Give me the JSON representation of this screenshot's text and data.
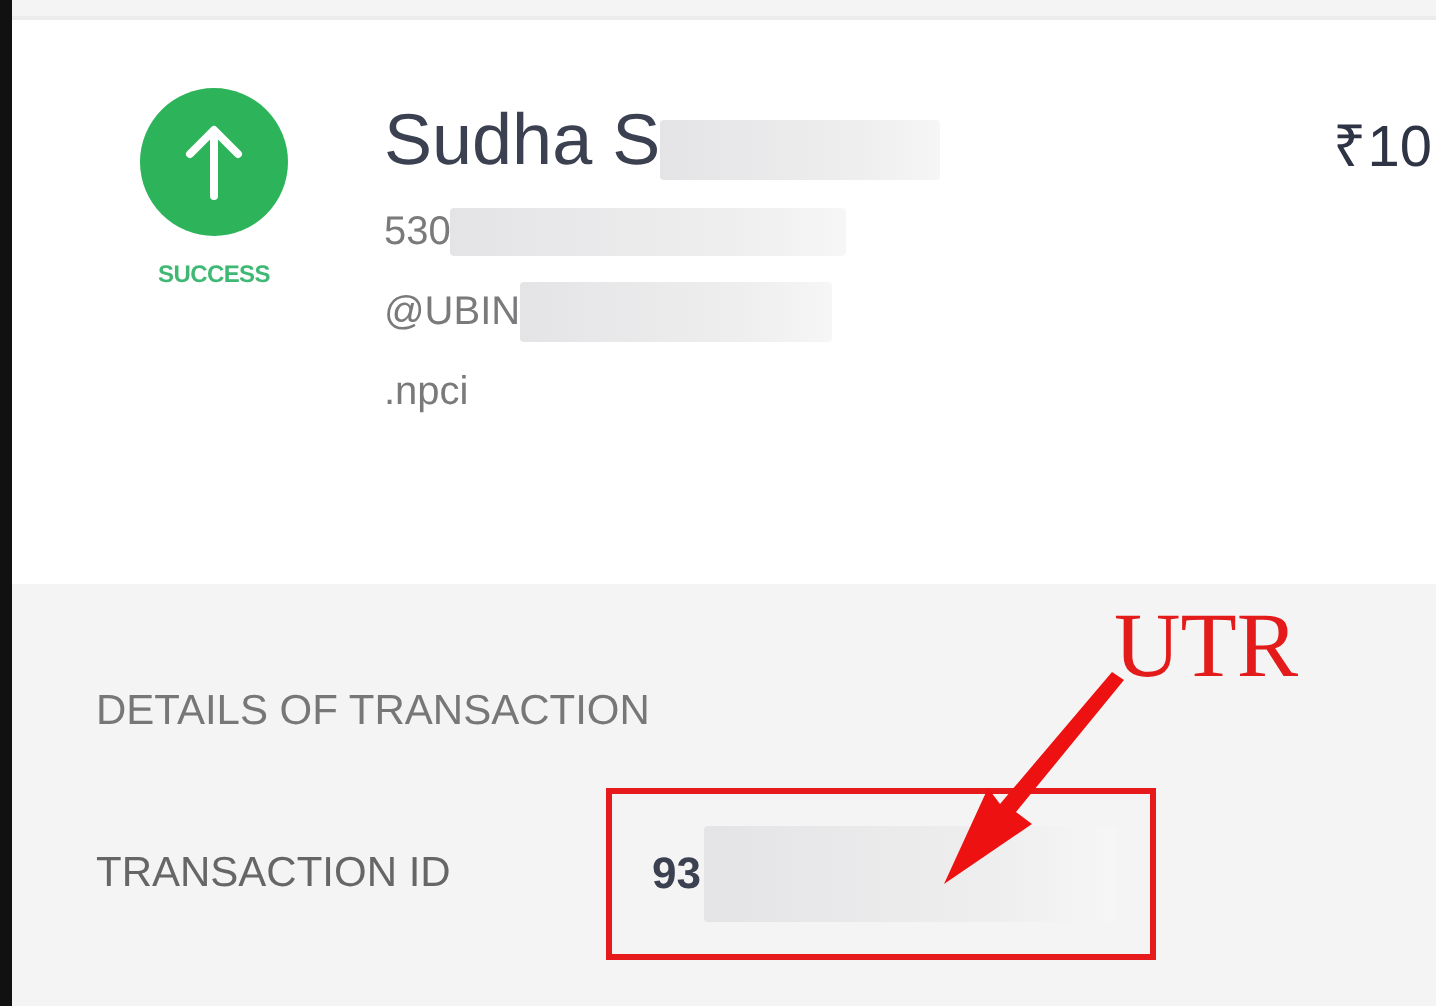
{
  "payment": {
    "status": "SUCCESS",
    "name": "Sudha S",
    "account": "530",
    "vpa": "@UBIN",
    "vpa_suffix": ".npci",
    "amount": "₹10"
  },
  "details": {
    "heading": "DETAILS OF TRANSACTION",
    "rows": [
      {
        "label": "TRANSACTION ID",
        "value": "93",
        "highlighted": true
      }
    ]
  },
  "annotation": {
    "label": "UTR"
  }
}
